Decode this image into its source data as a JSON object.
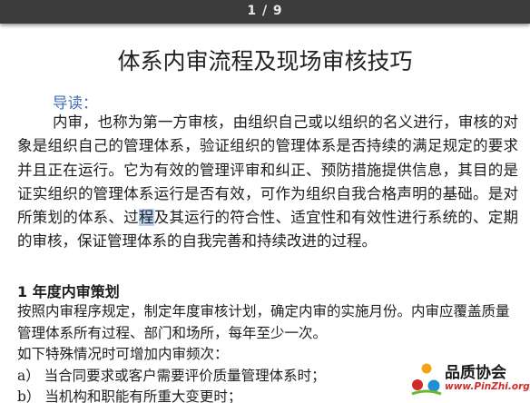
{
  "viewer": {
    "page_indicator": "1 / 9"
  },
  "document": {
    "title": "体系内审流程及现场审核技巧",
    "intro_label": "导读：",
    "intro_before_highlight": "内审，也称为第一方审核，由组织自己或以组织的名义进行，审核的对象是组织自己的管理体系，验证组织的管理体系是否持续的满足规定的要求并且正在运行。它为有效的管理评审和纠正、预防措施提供信息，其目的是证实组织的管理体系运行是否有效，可作为组织自我合格声明的基础。是对所策划的体系、过",
    "intro_highlight": "程",
    "intro_after_highlight": "及其运行的符合性、适宜性和有效性进行系统的、定期的审核，保证管理体系的自我完善和持续改进的过程。",
    "section_heading": "1 年度内审策划",
    "section_para1": "按照内审程序规定，制定年度审核计划，确定内审的实施月份。内审应覆盖质量管理体系所有过程、部门和场所，每年至少一次。",
    "section_para2": "如下特殊情况时可增加内审频次：",
    "section_item_a": "a） 当合同要求或客户需要评价质量管理体系时；",
    "section_item_b": "b） 当机构和职能有所重大变更时；"
  },
  "watermark": {
    "name": "品质协会",
    "url": "www.PinZhi.org"
  },
  "colors": {
    "toolbar_bg": "#3b3b3b",
    "intro_label": "#3f6eb4",
    "highlight": "#b9d3ee",
    "watermark_url": "#d12a2a"
  }
}
